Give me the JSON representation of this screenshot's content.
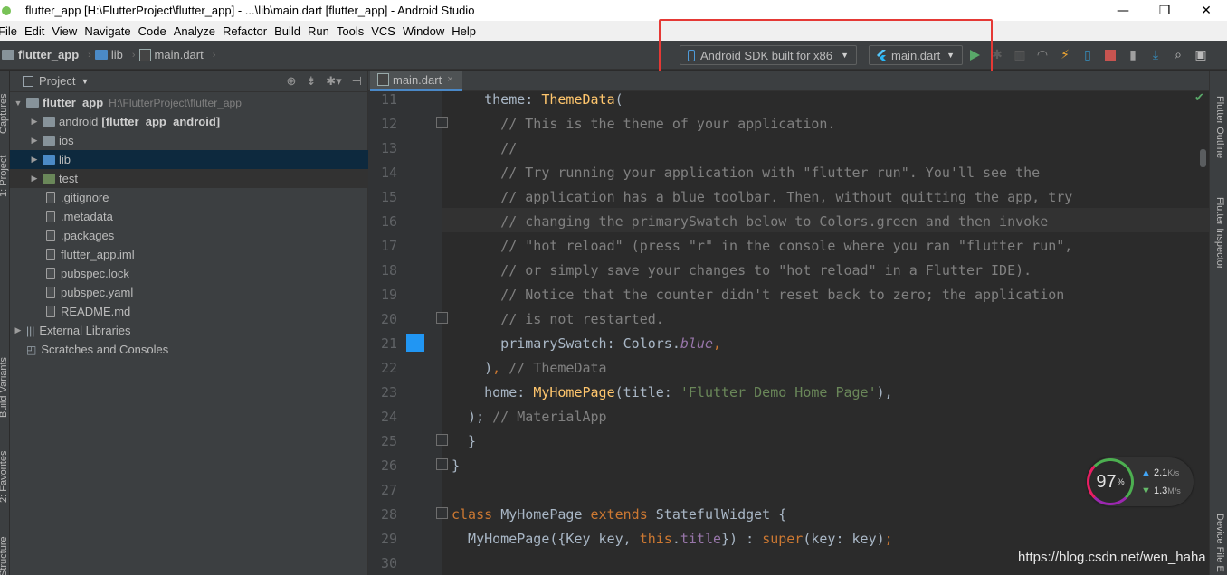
{
  "window": {
    "title": "flutter_app [H:\\FlutterProject\\flutter_app] - ...\\lib\\main.dart [flutter_app] - Android Studio",
    "minimize": "—",
    "restore": "❐",
    "close": "✕"
  },
  "menu": [
    "File",
    "Edit",
    "View",
    "Navigate",
    "Code",
    "Analyze",
    "Refactor",
    "Build",
    "Run",
    "Tools",
    "VCS",
    "Window",
    "Help"
  ],
  "breadcrumb": {
    "project": "flutter_app",
    "folder": "lib",
    "file": "main.dart"
  },
  "run_config": {
    "device": "Android SDK built for x86",
    "target": "main.dart"
  },
  "project_panel": {
    "title": "Project",
    "tree": [
      {
        "label": "flutter_app",
        "extra": "H:\\FlutterProject\\flutter_app",
        "type": "root"
      },
      {
        "label": "android",
        "extra": "[flutter_app_android]",
        "type": "folder"
      },
      {
        "label": "ios",
        "type": "folder"
      },
      {
        "label": "lib",
        "type": "folder"
      },
      {
        "label": "test",
        "type": "folder"
      },
      {
        "label": ".gitignore",
        "type": "file"
      },
      {
        "label": ".metadata",
        "type": "file"
      },
      {
        "label": ".packages",
        "type": "file"
      },
      {
        "label": "flutter_app.iml",
        "type": "file"
      },
      {
        "label": "pubspec.lock",
        "type": "file"
      },
      {
        "label": "pubspec.yaml",
        "type": "file"
      },
      {
        "label": "README.md",
        "type": "file"
      },
      {
        "label": "External Libraries",
        "type": "lib"
      },
      {
        "label": "Scratches and Consoles",
        "type": "scratch"
      }
    ]
  },
  "left_tools": [
    "Captures",
    "1: Project",
    "Build Variants",
    "2: Favorites",
    "Structure"
  ],
  "right_tools": [
    "Flutter Outline",
    "Flutter Inspector",
    "Device File E"
  ],
  "editor": {
    "tab": "main.dart",
    "tab_close": "×",
    "line_numbers": [
      "11",
      "12",
      "13",
      "14",
      "15",
      "16",
      "17",
      "18",
      "19",
      "20",
      "21",
      "22",
      "23",
      "24",
      "25",
      "26",
      "27",
      "28",
      "29",
      "30"
    ]
  },
  "speed_widget": {
    "percent": "97",
    "percent_unit": "%",
    "up": "2.1",
    "up_unit": "K/s",
    "down": "1.3",
    "down_unit": "M/s"
  },
  "watermark": "https://blog.csdn.net/wen_haha",
  "colors": {
    "highlight_box": "#e53935",
    "swatch": "#2196f3"
  }
}
